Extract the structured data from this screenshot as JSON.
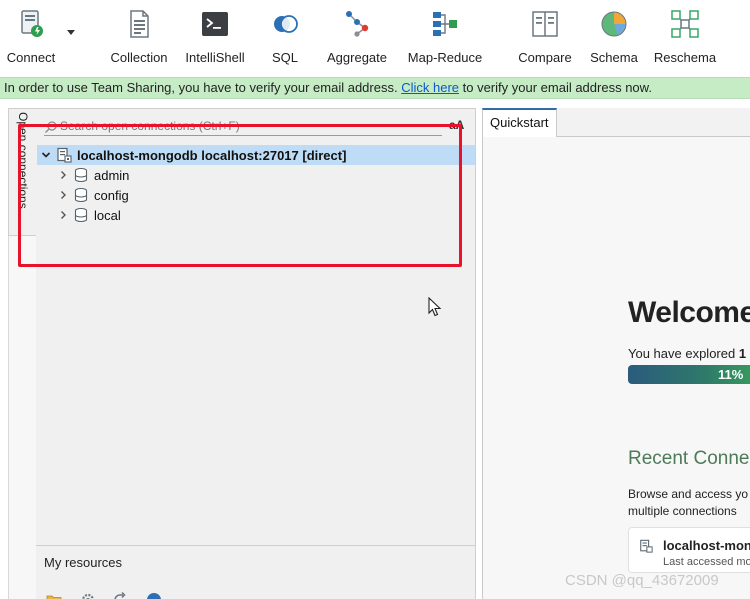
{
  "toolbar": {
    "connect": "Connect",
    "collection": "Collection",
    "intellishell": "IntelliShell",
    "sql": "SQL",
    "aggregate": "Aggregate",
    "map_reduce": "Map-Reduce",
    "compare": "Compare",
    "schema": "Schema",
    "reschema": "Reschema"
  },
  "notice": {
    "before": "In order to use Team Sharing, you have to verify your email address.",
    "link": "Click here",
    "after": "to verify your email address now."
  },
  "connections_panel": {
    "side_tab": "Open connections",
    "search_placeholder": "Search open connections (Ctrl+F)",
    "font_toggle": "aA",
    "connection": "localhost-mongodb localhost:27017 [direct]",
    "databases": [
      "admin",
      "config",
      "local"
    ]
  },
  "resources_panel": {
    "title": "My resources"
  },
  "quickstart": {
    "tab": "Quickstart",
    "welcome": "Welcome",
    "explored_prefix": "You have explored",
    "explored_count": "1",
    "progress_text": "11%",
    "progress_fraction": 0.11,
    "recent_title": "Recent Conne",
    "recent_desc_line1": "Browse and access yo",
    "recent_desc_line2": "multiple connections",
    "card_name": "localhost-mong",
    "card_sub": "Last accessed mor"
  },
  "watermark": "CSDN @qq_43672009",
  "colors": {
    "notice_bg": "#c6ecc6",
    "selection": "#bedcf5",
    "highlight_box": "#e8122b",
    "accent_green": "#4f7a58"
  }
}
